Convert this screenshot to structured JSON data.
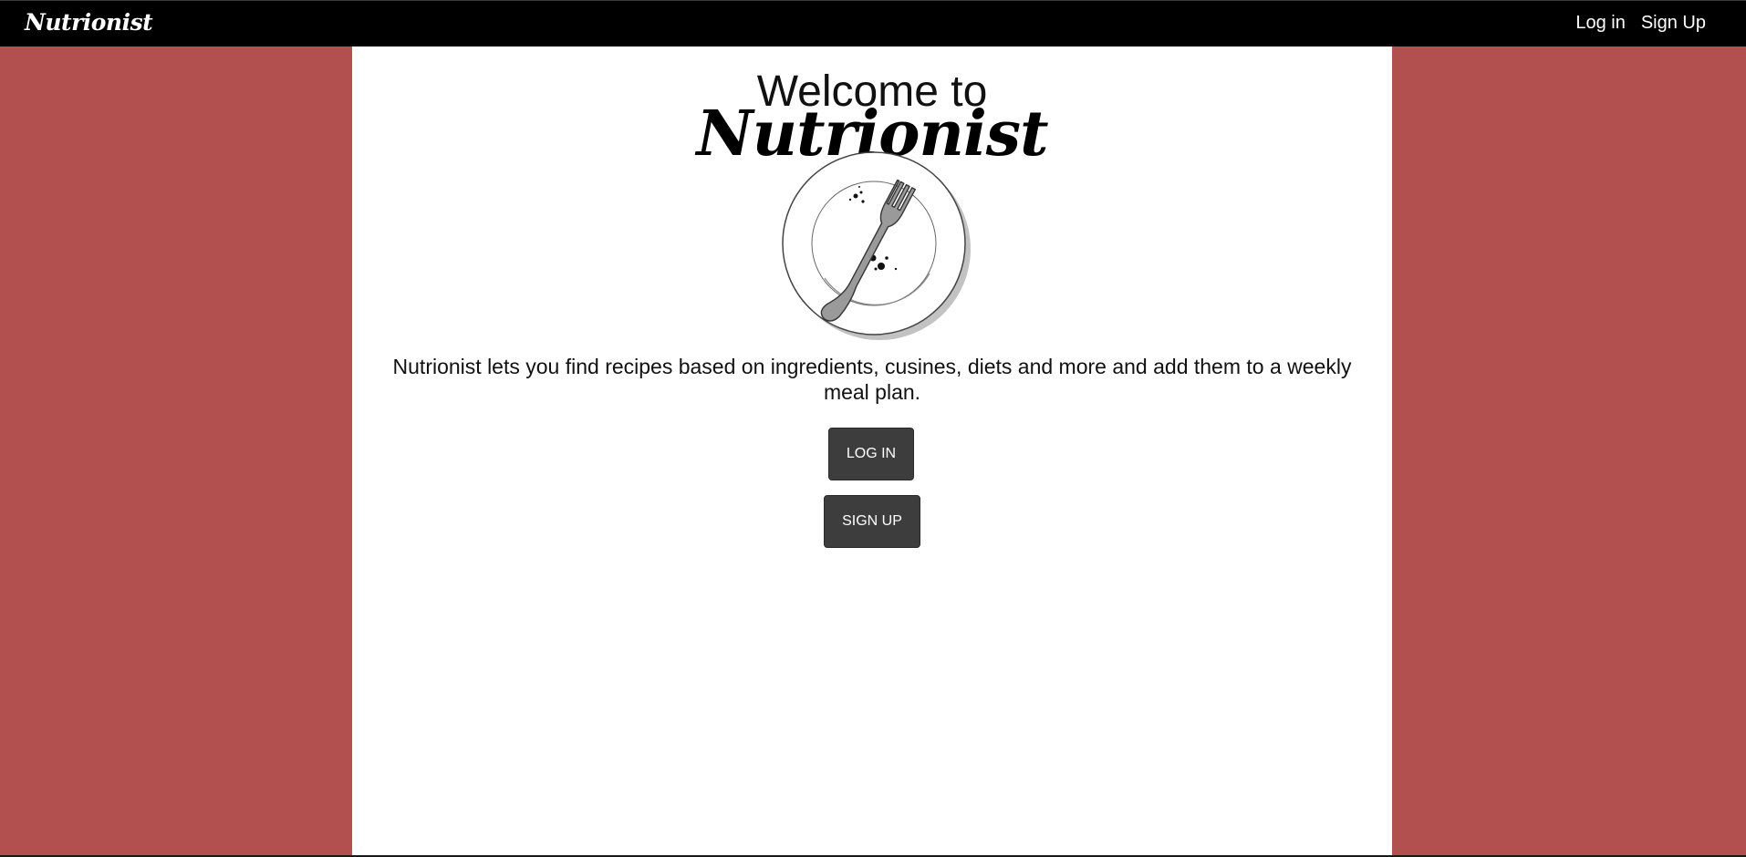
{
  "header": {
    "brand": "Nutrionist",
    "nav": {
      "login_label": "Log in",
      "signup_label": "Sign Up"
    }
  },
  "main": {
    "welcome": "Welcome to",
    "logo_text": "Nutrionist",
    "description": "Nutrionist lets you find recipes based on ingredients, cusines, diets and more and add them to a weekly meal plan.",
    "login_button": "LOG IN",
    "signup_button": "SIGN UP"
  },
  "colors": {
    "background": "#b24f4f",
    "navbar": "#000000",
    "content": "#ffffff",
    "button": "#3d3d3d"
  },
  "icons": {
    "hero": "plate-with-fork-icon"
  }
}
